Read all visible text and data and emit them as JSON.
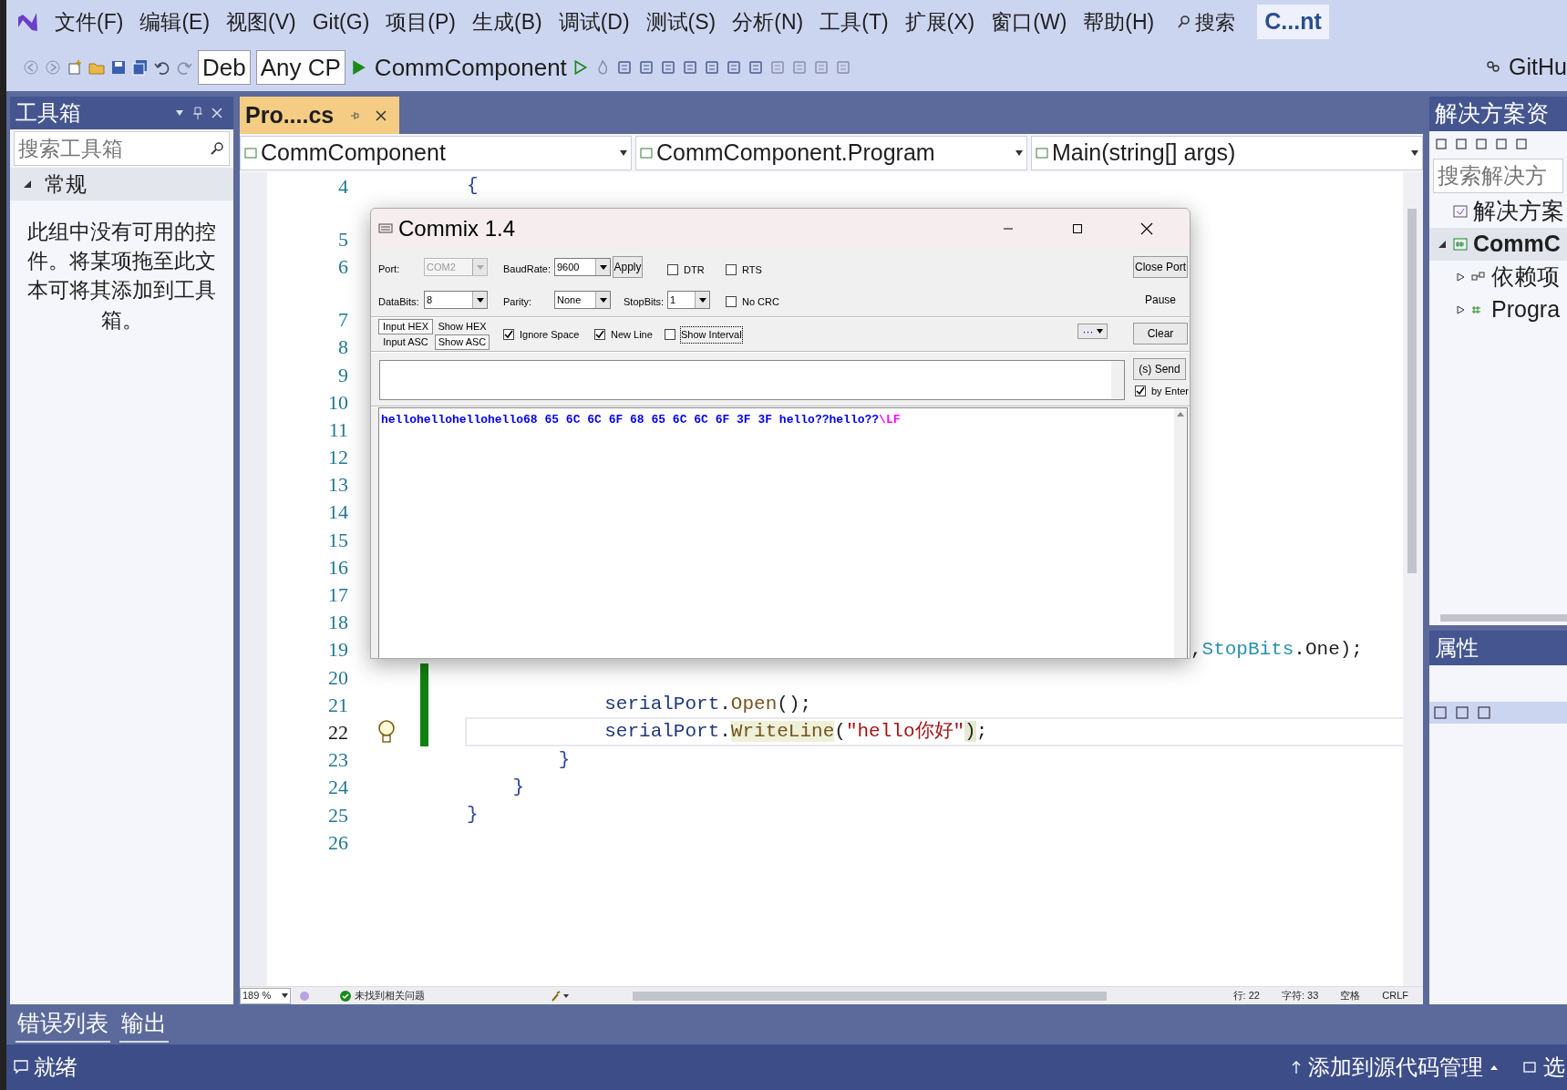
{
  "menu": [
    {
      "label": "文件(F)"
    },
    {
      "label": "编辑(E)"
    },
    {
      "label": "视图(V)"
    },
    {
      "label": "Git(G)"
    },
    {
      "label": "项目(P)"
    },
    {
      "label": "生成(B)"
    },
    {
      "label": "调试(D)"
    },
    {
      "label": "测试(S)"
    },
    {
      "label": "分析(N)"
    },
    {
      "label": "工具(T)"
    },
    {
      "label": "扩展(X)"
    },
    {
      "label": "窗口(W)"
    },
    {
      "label": "帮助(H)"
    }
  ],
  "search": {
    "label": "搜索"
  },
  "solution_badge": "C...nt",
  "toolbar": {
    "configuration": "Deb",
    "platform": "Any CP",
    "start": "CommComponent",
    "github": "GitHu"
  },
  "toolbox": {
    "title": "工具箱",
    "placeholder": "搜索工具箱",
    "group": {
      "label": "常规",
      "expanded": true
    },
    "empty_text": "此组中没有可用的控件。将某项拖至此文本可将其添加到工具箱。"
  },
  "editor": {
    "tab": {
      "label": "Pro....cs"
    },
    "nav": [
      "CommComponent",
      "CommComponent.Program",
      "Main(string[] args)"
    ],
    "lines": [
      {
        "kind": "code",
        "number": "4",
        "current": false,
        "changed": false,
        "lightbulb": false,
        "tokens": [
          {
            "text": "{",
            "kind": "brace"
          }
        ]
      },
      {
        "kind": "lens"
      },
      {
        "kind": "code",
        "number": "5",
        "current": false
      },
      {
        "kind": "code",
        "number": "6",
        "current": false
      },
      {
        "kind": "lens"
      },
      {
        "kind": "code",
        "number": "7",
        "current": false
      },
      {
        "kind": "code",
        "number": "8",
        "current": false
      },
      {
        "kind": "code",
        "number": "9",
        "current": false
      },
      {
        "kind": "code",
        "number": "10",
        "current": false
      },
      {
        "kind": "code",
        "number": "11",
        "current": false
      },
      {
        "kind": "code",
        "number": "12",
        "current": false
      },
      {
        "kind": "code",
        "number": "13",
        "current": false
      },
      {
        "kind": "code",
        "number": "14",
        "current": false
      },
      {
        "kind": "code",
        "number": "15",
        "current": false
      },
      {
        "kind": "code",
        "number": "16",
        "current": false
      },
      {
        "kind": "code",
        "number": "17",
        "current": false
      },
      {
        "kind": "code",
        "number": "18",
        "current": false
      },
      {
        "kind": "code",
        "number": "19",
        "current": false,
        "tokens": [
          {
            "text": "                                                               ,",
            "kind": "plain"
          },
          {
            "text": "StopBits",
            "kind": "type"
          },
          {
            "text": ".One);",
            "kind": "plain"
          }
        ]
      },
      {
        "kind": "code",
        "number": "20",
        "current": false,
        "changed": true,
        "lightbulb": false
      },
      {
        "kind": "code",
        "number": "21",
        "current": false,
        "changed": true,
        "lightbulb": false,
        "tokens": [
          {
            "text": "            serialPort",
            "kind": "ident"
          },
          {
            "text": ".",
            "kind": "plain"
          },
          {
            "text": "Open",
            "kind": "method"
          },
          {
            "text": "();",
            "kind": "plain"
          }
        ]
      },
      {
        "kind": "code",
        "number": "22",
        "current": true,
        "changed": true,
        "lightbulb": true,
        "tokens": [
          {
            "text": "            serialPort",
            "kind": "ident"
          },
          {
            "text": ".",
            "kind": "plain"
          },
          {
            "text": "WriteLine",
            "kind": "method_ref"
          },
          {
            "text": "(",
            "kind": "plain"
          },
          {
            "text": "\"hello你好\"",
            "kind": "string"
          },
          {
            "text": ")",
            "kind": "brace_match"
          },
          {
            "text": ";",
            "kind": "plain"
          }
        ]
      },
      {
        "kind": "code",
        "number": "23",
        "current": false,
        "changed": false,
        "lightbulb": false,
        "tokens": [
          {
            "text": "        }",
            "kind": "brace"
          }
        ]
      },
      {
        "kind": "code",
        "number": "24",
        "current": false,
        "changed": false,
        "lightbulb": false,
        "tokens": [
          {
            "text": "    }",
            "kind": "brace"
          }
        ]
      },
      {
        "kind": "code",
        "number": "25",
        "current": false,
        "changed": false,
        "lightbulb": false,
        "tokens": [
          {
            "text": "}",
            "kind": "brace"
          }
        ]
      },
      {
        "kind": "code",
        "number": "26",
        "current": false,
        "changed": false,
        "lightbulb": false
      }
    ],
    "status": {
      "zoom": "189 %",
      "issues": "未找到相关问题",
      "line": "行: 22",
      "char": "字符: 33",
      "spaces": "空格",
      "eol": "CRLF"
    }
  },
  "commix": {
    "title": "Commix 1.4",
    "port": {
      "label": "Port:",
      "value": "COM2",
      "disabled": true
    },
    "baudrate": {
      "label": "BaudRate:",
      "value": "9600",
      "disabled": false
    },
    "apply": "Apply",
    "dtr": {
      "label": "DTR",
      "checked": false
    },
    "rts": {
      "label": "RTS",
      "checked": false
    },
    "close_port": "Close Port",
    "databits": {
      "label": "DataBits:",
      "value": "8",
      "disabled": false
    },
    "parity": {
      "label": "Parity:",
      "value": "None",
      "disabled": false
    },
    "stopbits": {
      "label": "StopBits:",
      "value": "1",
      "disabled": false
    },
    "no_crc": {
      "label": "No CRC",
      "checked": false
    },
    "pause": "Pause",
    "input_modes": [
      {
        "label": "Input HEX",
        "selected": true
      },
      {
        "label": "Input ASC",
        "selected": false
      }
    ],
    "show_modes": [
      {
        "label": "Show HEX",
        "selected": false
      },
      {
        "label": "Show ASC",
        "selected": true
      }
    ],
    "options": [
      {
        "label": "Ignore Space",
        "checked": true,
        "focused": false
      },
      {
        "label": "New Line",
        "checked": true,
        "focused": false
      },
      {
        "label": "Show Interval",
        "checked": false,
        "focused": true
      }
    ],
    "more": "···",
    "clear": "Clear",
    "send": "(s) Send",
    "by_enter": {
      "label": "by Enter",
      "checked": true
    },
    "output": [
      {
        "text": "hellohellohellohello68 65 6C 6C 6F 68 65 6C 6C 6F 3F 3F hello??hello??",
        "kind": "data"
      },
      {
        "text": "\\LF",
        "kind": "control"
      }
    ]
  },
  "solution_explorer": {
    "title": "解决方案资",
    "placeholder": "搜索解决方",
    "tree": [
      {
        "label": "解决方案",
        "kind": "solution",
        "selected": false,
        "bold": false
      },
      {
        "label": "CommC",
        "kind": "project",
        "expanded": true,
        "selected": true,
        "bold": true,
        "children": [
          {
            "label": "依赖项",
            "kind": "dependencies",
            "expanded": false,
            "selected": false,
            "bold": false
          },
          {
            "label": "Progra",
            "kind": "csharp",
            "expanded": false,
            "selected": false,
            "bold": false
          }
        ]
      }
    ]
  },
  "properties": {
    "title": "属性"
  },
  "bottom_tabs": [
    {
      "label": "错误列表"
    },
    {
      "label": "输出"
    }
  ],
  "status_bar": {
    "ready": "就绪",
    "source_control": "添加到源代码管理",
    "select": "选"
  }
}
